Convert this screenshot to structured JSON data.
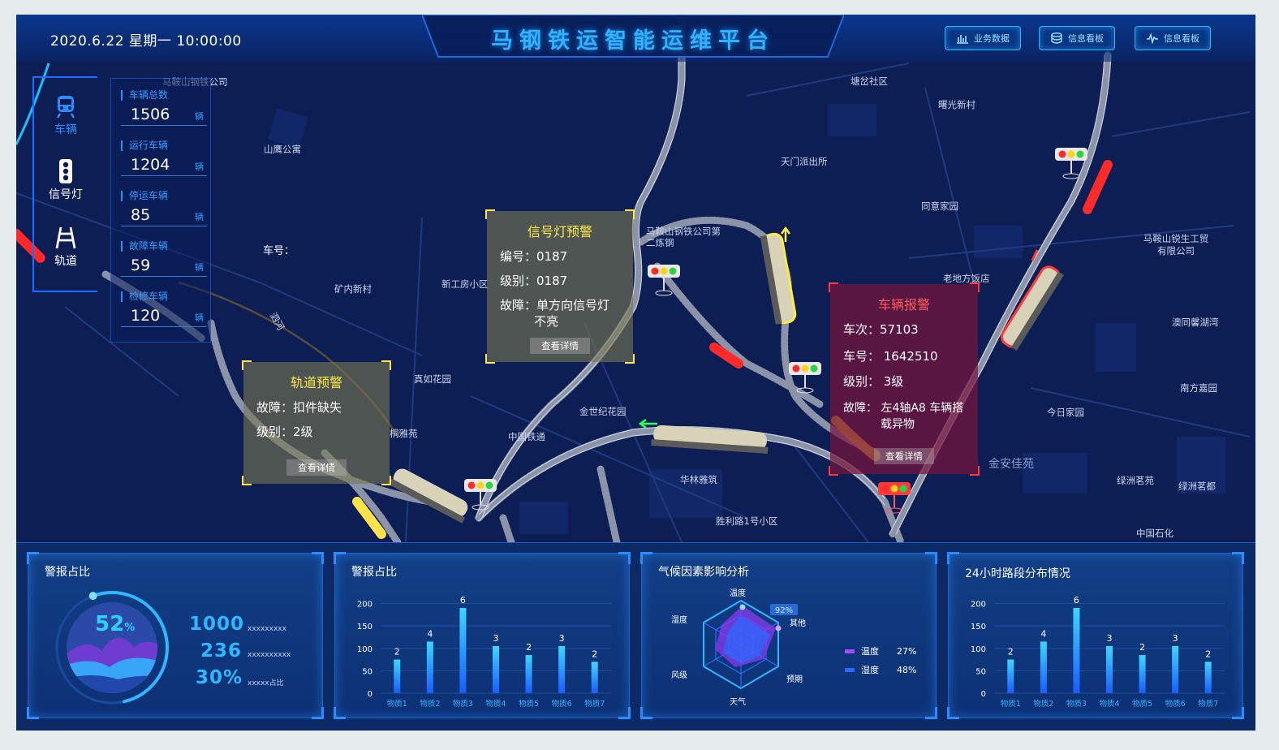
{
  "header": {
    "datetime": "2020.6.22  星期一  10:00:00",
    "title": "马钢铁运智能运维平台",
    "buttons": [
      {
        "label": "业务数据",
        "icon": "bar-chart-icon"
      },
      {
        "label": "信息看板",
        "icon": "database-icon"
      },
      {
        "label": "信息看板",
        "icon": "pulse-icon"
      }
    ]
  },
  "nav": {
    "items": [
      {
        "label": "车辆",
        "icon": "train-icon",
        "active": true
      },
      {
        "label": "信号灯",
        "icon": "traffic-light-icon",
        "active": false
      },
      {
        "label": "轨道",
        "icon": "track-icon",
        "active": false
      }
    ]
  },
  "stats": [
    {
      "label": "车辆总数",
      "value": "1506",
      "unit": "辆"
    },
    {
      "label": "运行车辆",
      "value": "1204",
      "unit": "辆"
    },
    {
      "label": "停运车辆",
      "value": "85",
      "unit": "辆"
    },
    {
      "label": "故障车辆",
      "value": "59",
      "unit": "辆"
    },
    {
      "label": "检修车辆",
      "value": "120",
      "unit": "辆"
    }
  ],
  "map": {
    "car_number_label": "车号：",
    "labels": [
      "马鞍山钢铁公司",
      "山鹰公寓",
      "矿内新村",
      "新工房小区",
      "真如花园",
      "桐雅苑",
      "中国铁通",
      "金世纪花园",
      "华林雅筑",
      "胜利路1号小区",
      "马鞍山钢铁公司第二炼钢",
      "塘岔社区",
      "曙光新村",
      "天门派出所",
      "同意家园",
      "老地方饭店",
      "马鞍山锐生工贸有限公司",
      "南方嘉园",
      "今日家园",
      "金安佳苑",
      "绿洲茗苑",
      "绿洲茗都",
      "中国石化",
      "泗河",
      "澳同馨湖湾"
    ]
  },
  "popups": {
    "track": {
      "title": "轨道预警",
      "fault": "故障：扣件缺失",
      "level": "级别：2级",
      "button": "查看详情"
    },
    "signal": {
      "title": "信号灯预警",
      "id": "编号：0187",
      "level": "级别：0187",
      "fault_line1": "故障：单方向信号灯",
      "fault_line2": "不亮",
      "button": "查看详情"
    },
    "vehicle": {
      "title": "车辆报警",
      "trip": "车次：57103",
      "car": "车号：  1642510",
      "level": "级别：  3级",
      "fault_line1": "故障：   左4轴A8 车辆搭",
      "fault_line2": "载异物",
      "button": "查看详情"
    }
  },
  "bottom": {
    "gauge": {
      "title": "警报占比",
      "percent": "52",
      "percent_unit": "%",
      "progress": 0.52,
      "stats": [
        {
          "value": "1000",
          "label": "xxxxxxxxx"
        },
        {
          "value": "236",
          "label": "xxxxxxxxxx"
        },
        {
          "value": "30%",
          "label": "xxxxx占比"
        }
      ]
    },
    "bar_title": "警报占比",
    "radar": {
      "title": "气候因素影响分析",
      "axes": [
        "温度",
        "其他",
        "预期",
        "天气",
        "风级",
        "湿度"
      ],
      "badge": "92%",
      "legend": [
        {
          "name": "温度",
          "value": "27%",
          "color": "#a24cff"
        },
        {
          "name": "湿度",
          "value": "48%",
          "color": "#2a6bff"
        }
      ]
    },
    "dist_title": "24小时路段分布情况"
  },
  "chart_data": [
    {
      "type": "bar",
      "title": "警报占比",
      "categories": [
        "物质1",
        "物质2",
        "物质3",
        "物质4",
        "物质5",
        "物质6",
        "物质7"
      ],
      "values": [
        75,
        115,
        190,
        105,
        85,
        105,
        70
      ],
      "data_labels": [
        "2",
        "4",
        "6",
        "3",
        "2",
        "3",
        "2"
      ],
      "yticks": [
        0,
        50,
        100,
        150,
        200
      ],
      "ylim": [
        0,
        210
      ]
    },
    {
      "type": "bar",
      "title": "24小时路段分布情况",
      "categories": [
        "物质1",
        "物质2",
        "物质3",
        "物质4",
        "物质5",
        "物质6",
        "物质7"
      ],
      "values": [
        75,
        115,
        190,
        105,
        85,
        105,
        70
      ],
      "data_labels": [
        "2",
        "4",
        "6",
        "3",
        "2",
        "3",
        "2"
      ],
      "yticks": [
        0,
        50,
        100,
        150,
        200
      ],
      "ylim": [
        0,
        210
      ]
    }
  ]
}
